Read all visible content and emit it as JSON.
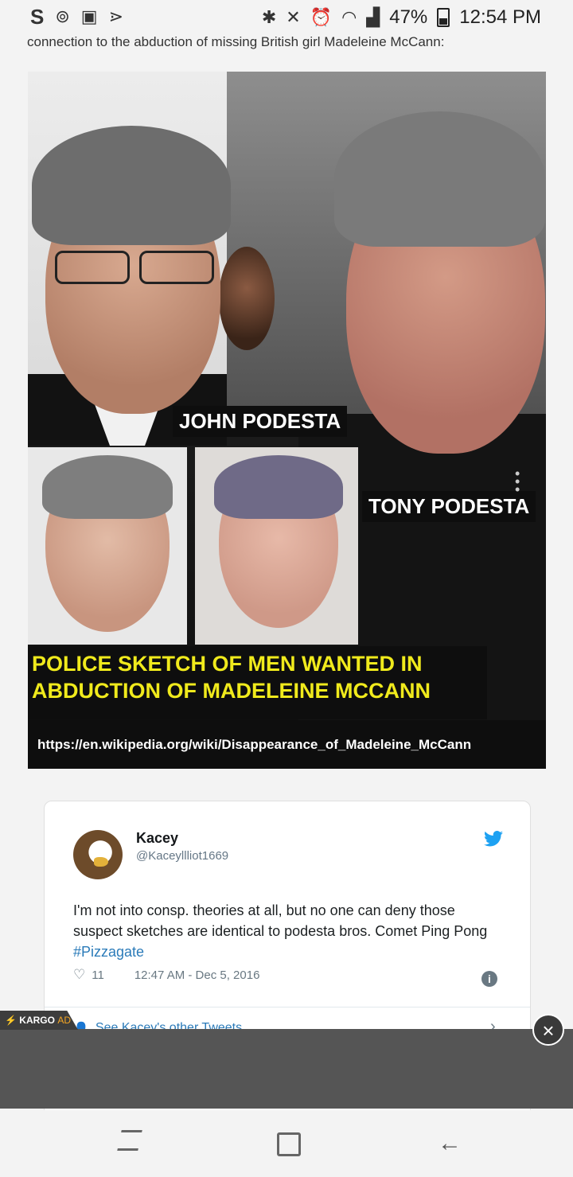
{
  "status_bar": {
    "left_icons": [
      "S",
      "⊚",
      "▣",
      "⋗"
    ],
    "right_icons": [
      "bluetooth-icon",
      "mute-icon",
      "alarm-icon",
      "wifi-icon",
      "signal-icon"
    ],
    "battery": "47%",
    "time": "12:54 PM"
  },
  "article": {
    "intro_text": "connection to the abduction of missing British girl Madeleine McCann:"
  },
  "meme": {
    "label_john": "JOHN PODESTA",
    "label_tony": "TONY PODESTA",
    "caption_line1": "POLICE SKETCH OF MEN WANTED IN",
    "caption_line2": "ABDUCTION OF MADELEINE MCCANN",
    "url": "https://en.wikipedia.org/wiki/Disappearance_of_Madeleine_McCann"
  },
  "tweet": {
    "name": "Kacey",
    "handle": "@Kaceyllliot1669",
    "text": "I'm not into consp. theories at all, but no one can deny those suspect sketches are identical to podesta bros. Comet Ping Pong",
    "hashtag": "#Pizzagate",
    "likes": "11",
    "timestamp": "12:47 AM - Dec 5, 2016",
    "footer_link": "See Kacey's other Tweets"
  },
  "ad": {
    "brand": "KARGO",
    "tag": "AD"
  },
  "colors": {
    "caption_yellow": "#f0ea1c",
    "twitter_blue": "#1da1f2",
    "link_blue": "#2b7bb9"
  }
}
